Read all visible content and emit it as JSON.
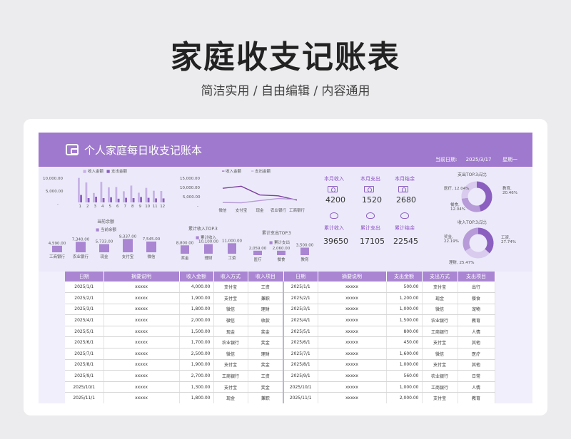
{
  "hero": {
    "title": "家庭收支记账表",
    "subtitle": "简洁实用 / 自由编辑 / 内容通用"
  },
  "banner": {
    "title": "个人家庭每日收支记账本",
    "date_label": "当前日期:",
    "date_value": "2025/3/17",
    "weekday": "星期一"
  },
  "bar_chart": {
    "legend": [
      "收入金额",
      "支出金额"
    ],
    "y_ticks": [
      "10,000.00",
      "5,000.00",
      "-"
    ],
    "chart_data": {
      "type": "bar",
      "categories": [
        "1",
        "2",
        "3",
        "4",
        "5",
        "6",
        "7",
        "8",
        "9",
        "10",
        "11",
        "12"
      ],
      "series": [
        {
          "name": "收入金额",
          "values": [
            8600,
            7000,
            3300,
            7200,
            5300,
            5400,
            3900,
            5900,
            3400,
            5100,
            4100,
            4000
          ]
        },
        {
          "name": "支出金额",
          "values": [
            2600,
            1500,
            2000,
            1500,
            1800,
            1300,
            1600,
            1500,
            1900,
            1600,
            1400,
            1400
          ]
        }
      ],
      "ylim": [
        0,
        10000
      ]
    }
  },
  "line_chart": {
    "legend": [
      "收入金额",
      "支出金额"
    ],
    "y_ticks": [
      "15,000.00",
      "10,000.00",
      "5,000.00",
      "-"
    ],
    "chart_data": {
      "type": "line",
      "categories": [
        "微信",
        "支付宝",
        "现金",
        "农业银行",
        "工商银行"
      ],
      "series": [
        {
          "name": "收入金额",
          "values": [
            9500,
            10700,
            5600,
            5100,
            2600
          ]
        },
        {
          "name": "支出金额",
          "values": [
            1200,
            1000,
            2300,
            3500,
            3000
          ]
        }
      ],
      "ylim": [
        0,
        15000
      ]
    }
  },
  "balance_chart": {
    "title": "当前余额",
    "legend": "当前余额",
    "chart_data": {
      "type": "bar",
      "categories": [
        "工商银行",
        "农业银行",
        "现金",
        "支付宝",
        "微信"
      ],
      "values": [
        4590,
        7340,
        5733,
        9337,
        7545
      ],
      "labels": [
        "4,590.00",
        "7,340.00",
        "5,733.00",
        "9,337.00",
        "7,545.00"
      ]
    }
  },
  "income_top3": {
    "title": "累计收入TOP.3",
    "legend": "累计收入",
    "chart_data": {
      "type": "bar",
      "categories": [
        "奖金",
        "理财",
        "工资"
      ],
      "values": [
        8800,
        10100,
        11000
      ],
      "labels": [
        "8,800.00",
        "10,100.00",
        "11,000.00"
      ]
    }
  },
  "expense_top3": {
    "title": "累计支出TOP.3",
    "legend": "累计支出",
    "chart_data": {
      "type": "bar",
      "categories": [
        "医疗",
        "餐食",
        "教育"
      ],
      "values": [
        2059,
        2060,
        3500
      ],
      "labels": [
        "2,059.00",
        "2,060.00",
        "3,500.00"
      ]
    }
  },
  "kpis": {
    "month_income": {
      "label": "本月收入",
      "value": "4200"
    },
    "month_expense": {
      "label": "本月支出",
      "value": "1520"
    },
    "month_balance": {
      "label": "本月结余",
      "value": "2680"
    },
    "total_income": {
      "label": "累计收入",
      "value": "39650"
    },
    "total_expense": {
      "label": "累计支出",
      "value": "17105"
    },
    "total_balance": {
      "label": "累计结余",
      "value": "22545"
    }
  },
  "expense_donut": {
    "title": "支出TOP.3占比",
    "chart_data": {
      "type": "pie",
      "slices": [
        {
          "label": "教育",
          "pct": "20.46%",
          "value": 20.46
        },
        {
          "label": "医疗",
          "pct": "12.04%",
          "value": 12.04
        },
        {
          "label": "餐食",
          "pct": "12.04%",
          "value": 12.04
        }
      ]
    }
  },
  "income_donut": {
    "title": "收入TOP.3占比",
    "chart_data": {
      "type": "pie",
      "slices": [
        {
          "label": "工资",
          "pct": "27.74%",
          "value": 27.74
        },
        {
          "label": "奖金",
          "pct": "22.19%",
          "value": 22.19
        },
        {
          "label": "理财",
          "pct": "25.47%",
          "value": 25.47
        }
      ]
    }
  },
  "table": {
    "headers": [
      "日期",
      "摘要说明",
      "收入金额",
      "收入方式",
      "收入项目",
      "日期",
      "摘要说明",
      "支出金额",
      "支出方式",
      "支出项目"
    ],
    "rows": [
      [
        "2025/1/1",
        "xxxxx",
        "4,000.00",
        "支付宝",
        "工资",
        "2025/1/1",
        "xxxxx",
        "500.00",
        "支付宝",
        "出行"
      ],
      [
        "2025/2/1",
        "xxxxx",
        "1,900.00",
        "支付宝",
        "兼职",
        "2025/2/1",
        "xxxxx",
        "1,200.00",
        "现金",
        "餐食"
      ],
      [
        "2025/3/1",
        "xxxxx",
        "1,800.00",
        "微信",
        "理财",
        "2025/3/1",
        "xxxxx",
        "1,000.00",
        "微信",
        "宠物"
      ],
      [
        "2025/4/1",
        "xxxxx",
        "2,000.00",
        "微信",
        "收款",
        "2025/4/1",
        "xxxxx",
        "1,500.00",
        "农业银行",
        "教育"
      ],
      [
        "2025/5/1",
        "xxxxx",
        "1,500.00",
        "现金",
        "奖金",
        "2025/5/1",
        "xxxxx",
        "800.00",
        "工商银行",
        "人情"
      ],
      [
        "2025/6/1",
        "xxxxx",
        "1,700.00",
        "农业银行",
        "奖金",
        "2025/6/1",
        "xxxxx",
        "450.00",
        "支付宝",
        "其他"
      ],
      [
        "2025/7/1",
        "xxxxx",
        "2,500.00",
        "微信",
        "理财",
        "2025/7/1",
        "xxxxx",
        "1,600.00",
        "微信",
        "医疗"
      ],
      [
        "2025/8/1",
        "xxxxx",
        "1,900.00",
        "支付宝",
        "奖金",
        "2025/8/1",
        "xxxxx",
        "1,000.00",
        "支付宝",
        "其他"
      ],
      [
        "2025/9/1",
        "xxxxx",
        "2,700.00",
        "工商银行",
        "工资",
        "2025/9/1",
        "xxxxx",
        "560.00",
        "农业银行",
        "日常"
      ],
      [
        "2025/10/1",
        "xxxxx",
        "1,300.00",
        "支付宝",
        "奖金",
        "2025/10/1",
        "xxxxx",
        "1,000.00",
        "工商银行",
        "人情"
      ],
      [
        "2025/11/1",
        "xxxxx",
        "1,800.00",
        "现金",
        "兼职",
        "2025/11/1",
        "xxxxx",
        "2,000.00",
        "支付宝",
        "教育"
      ]
    ]
  },
  "colors": {
    "accent": "#9f79cd",
    "bar_dark": "#8b5fc0",
    "bar_light": "#c7b2e6",
    "line_dark": "#7b3f9e",
    "line_light": "#b79bd8"
  }
}
